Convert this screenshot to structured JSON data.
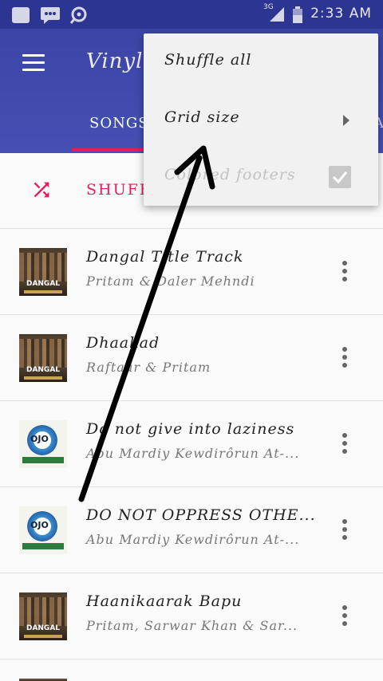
{
  "status_bar": {
    "network": "3G",
    "time": "2:33 AM"
  },
  "app_bar": {
    "title": "Vinyl",
    "tabs": [
      {
        "label": "SONGS"
      }
    ]
  },
  "shuffle_row": {
    "label": "SHUFFLE"
  },
  "songs": [
    {
      "title": "Dangal Title Track",
      "artist": "Pritam & Daler Mehndi",
      "art_label": "DANGAL"
    },
    {
      "title": "Dhaakad",
      "artist": "Raftaar & Pritam",
      "art_label": "DANGAL"
    },
    {
      "title": "Do not give into laziness",
      "artist": "Abu Mardiy Kewdirôrun At-...",
      "art_label": "OJO"
    },
    {
      "title": "DO NOT OPPRESS OTHE...",
      "artist": "Abu Mardiy Kewdirôrun At-...",
      "art_label": "OJO"
    },
    {
      "title": "Haanikaarak Bapu",
      "artist": "Pritam, Sarwar Khan & Sar...",
      "art_label": "DANGAL"
    }
  ],
  "overflow_menu": {
    "items": [
      {
        "label": "Shuffle all"
      },
      {
        "label": "Grid size"
      },
      {
        "label": "Colored footers",
        "checked": true,
        "enabled": false
      }
    ]
  },
  "colors": {
    "primary": "#3f4aa9",
    "status_bar": "#2c3592",
    "accent": "#ec1a5a"
  },
  "icons": [
    "menu-icon",
    "shuffle-icon",
    "more-vert-icon",
    "submenu-arrow-icon",
    "checkbox-icon"
  ]
}
